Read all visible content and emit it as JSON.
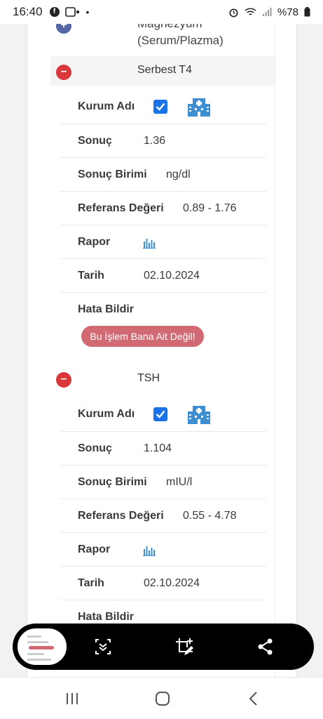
{
  "status_bar": {
    "time": "16:40",
    "battery": "%78",
    "icons": [
      "facebook-icon",
      "notification-app-icon",
      "alarm-icon",
      "wifi-icon",
      "signal-icon",
      "battery-icon"
    ]
  },
  "previous_item": {
    "title_line1": "Magnezyum",
    "title_line2": "(Serum/Plazma)"
  },
  "tests": [
    {
      "title": "Serbest T4",
      "institution_label": "Kurum Adı",
      "result_label": "Sonuç",
      "result_value": "1.36",
      "unit_label": "Sonuç Birimi",
      "unit_value": "ng/dl",
      "reference_label": "Referans Değeri",
      "reference_value": "0.89 - 1.76",
      "report_label": "Rapor",
      "date_label": "Tarih",
      "date_value": "02.10.2024",
      "error_label": "Hata Bildir",
      "error_button": "Bu İşlem Bana Ait Değil!"
    },
    {
      "title": "TSH",
      "institution_label": "Kurum Adı",
      "result_label": "Sonuç",
      "result_value": "1.104",
      "unit_label": "Sonuç Birimi",
      "unit_value": "mIU/l",
      "reference_label": "Referans Değeri",
      "reference_value": "0.55 - 4.78",
      "report_label": "Rapor",
      "date_label": "Tarih",
      "date_value": "02.10.2024",
      "error_label": "Hata Bildir"
    }
  ],
  "toggle_symbols": {
    "expanded": "–",
    "collapsed": "+"
  },
  "colors": {
    "minus_toggle": "#d9383a",
    "plus_toggle": "#5468a8",
    "checkbox": "#1a73e8",
    "hospital_icon": "#3d8fd1",
    "error_button": "#d26a74"
  },
  "screenshot_toolbar": {
    "icons": [
      "screenshot-thumbnail",
      "scroll-capture-icon",
      "crop-edit-icon",
      "share-icon"
    ]
  },
  "nav_bar": {
    "icons": [
      "recent-apps-icon",
      "home-icon",
      "back-icon"
    ]
  }
}
